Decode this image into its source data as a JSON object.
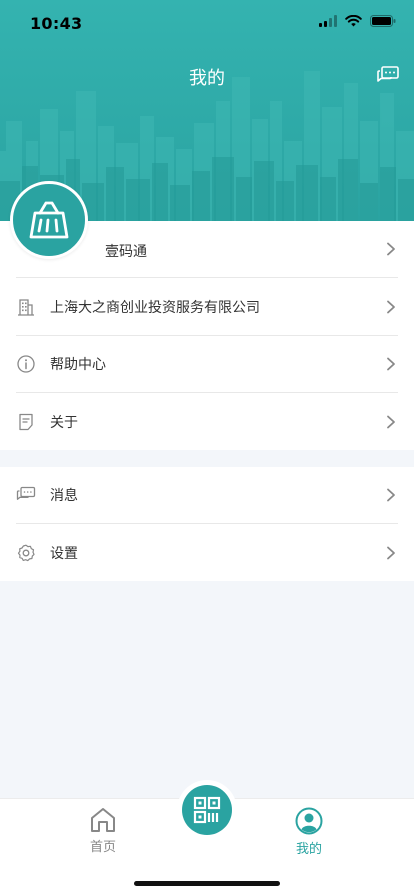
{
  "status_bar": {
    "time": "10:43"
  },
  "header": {
    "title": "我的",
    "message_icon": "chat-icon"
  },
  "profile": {
    "name": "壹码通",
    "avatar_icon": "shopping-bag-icon"
  },
  "menu": {
    "company": {
      "label": "上海大之商创业投资服务有限公司",
      "icon": "building-icon"
    },
    "help": {
      "label": "帮助中心",
      "icon": "info-icon"
    },
    "about": {
      "label": "关于",
      "icon": "document-icon"
    }
  },
  "settings_menu": {
    "messages": {
      "label": "消息",
      "icon": "chat-icon"
    },
    "settings": {
      "label": "设置",
      "icon": "gear-icon"
    }
  },
  "tabbar": {
    "home": {
      "label": "首页",
      "icon": "home-icon"
    },
    "scan": {
      "icon": "qr-code-icon"
    },
    "mine": {
      "label": "我的",
      "icon": "user-icon",
      "active": true
    }
  },
  "colors": {
    "accent": "#2aa3a1",
    "background": "#f3f6fa"
  }
}
